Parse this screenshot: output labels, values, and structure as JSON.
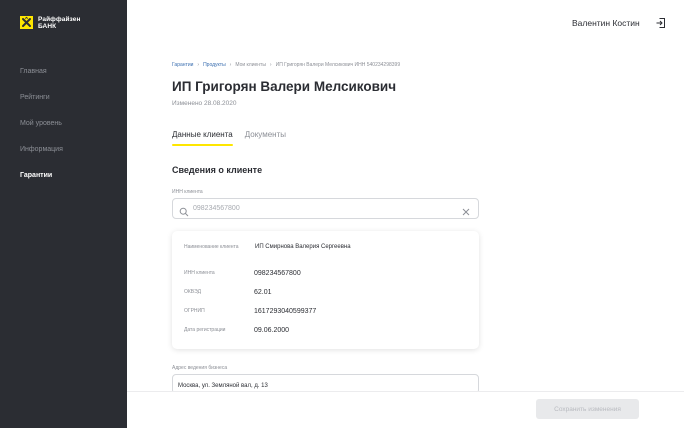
{
  "brand": {
    "line1": "Райффайзен",
    "line2": "БАНК",
    "accent": "#fee600",
    "sidebar_bg": "#2b2d33"
  },
  "nav": {
    "items": [
      {
        "label": "Главная"
      },
      {
        "label": "Рейтинги"
      },
      {
        "label": "Мой уровень"
      },
      {
        "label": "Информация"
      },
      {
        "label": "Гарантии",
        "active": true
      }
    ]
  },
  "header": {
    "user_name": "Валентин Костин",
    "logout_icon": "logout-icon"
  },
  "breadcrumb": {
    "items": [
      "Гарантии",
      "Продукты",
      "Мои клиенты",
      "ИП Григорян Валери Мелсикович ИНН 540234298399"
    ]
  },
  "page": {
    "title": "ИП Григорян Валери Мелсикович",
    "modified": "Изменено 28.08.2020"
  },
  "tabs": [
    {
      "label": "Данные клиента",
      "active": true
    },
    {
      "label": "Документы",
      "active": false
    }
  ],
  "section": {
    "title": "Сведения о клиенте"
  },
  "inn_field": {
    "label": "ИНН клиента",
    "value": "098234567800"
  },
  "client_card": {
    "rows": [
      {
        "key": "Наименование клиента",
        "value": "ИП Смирнова Валерия Сергеевна"
      },
      {
        "key": "ИНН клиента",
        "value": "098234567800"
      },
      {
        "key": "ОКВЭД",
        "value": "62.01"
      },
      {
        "key": "ОГРНИП",
        "value": "1617293040599377"
      },
      {
        "key": "Дата регистрации",
        "value": "09.06.2000"
      }
    ]
  },
  "address_field": {
    "label": "Адрес ведения бизнеса",
    "value": "Москва, ул. Земляной вал, д. 13"
  },
  "footer": {
    "save_label": "Сохранить изменения"
  }
}
